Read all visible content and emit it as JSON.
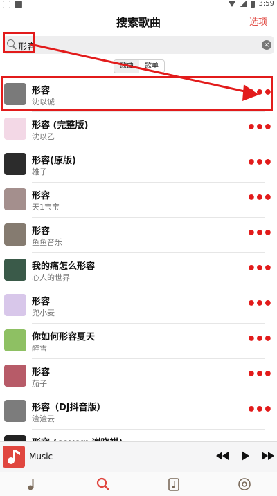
{
  "status": {
    "time": "3:59"
  },
  "header": {
    "title": "搜索歌曲",
    "options_label": "选项"
  },
  "search": {
    "value": "形容"
  },
  "segments": {
    "songs": "歌曲",
    "albums": "歌单"
  },
  "songs": [
    {
      "name": "形容",
      "artist": "沈以诚",
      "thumb_color": "#7a7a7a"
    },
    {
      "name": "形容 (完整版)",
      "artist": "沈以乙",
      "thumb_color": "#f3d8e6"
    },
    {
      "name": "形容(原版)",
      "artist": "雄子",
      "thumb_color": "#2c2c2c"
    },
    {
      "name": "形容",
      "artist": "天1宝宝",
      "thumb_color": "#a48f8d"
    },
    {
      "name": "形容",
      "artist": "鱼鱼音乐",
      "thumb_color": "#857b70"
    },
    {
      "name": "我的痛怎么形容",
      "artist": "心人的世界",
      "thumb_color": "#3a5a49"
    },
    {
      "name": "形容",
      "artist": "兜小麦",
      "thumb_color": "#d8c7ea"
    },
    {
      "name": "你如何形容夏天",
      "artist": "醉雪",
      "thumb_color": "#8ec063"
    },
    {
      "name": "形容",
      "artist": "茄子",
      "thumb_color": "#b75b68"
    },
    {
      "name": "形容（DJ抖音版）",
      "artist": "渣渣云",
      "thumb_color": "#7c7c7c"
    },
    {
      "name": "形容 (cover: 谢晓祺)",
      "artist": "",
      "thumb_color": "#222222"
    }
  ],
  "player": {
    "title": "Music",
    "accent": "#e0463f"
  },
  "colors": {
    "highlight": "#e21b1b",
    "accent": "#e0463f"
  }
}
